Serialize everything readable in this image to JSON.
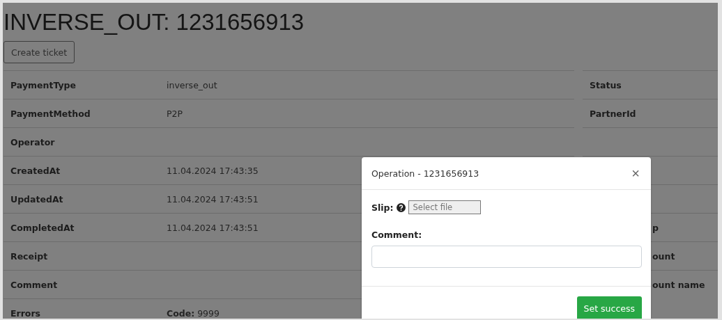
{
  "page": {
    "title": "INVERSE_OUT: 1231656913",
    "create_ticket_button": "Create ticket"
  },
  "details": {
    "rows": [
      {
        "label": "PaymentType",
        "value": "inverse_out"
      },
      {
        "label": "PaymentMethod",
        "value": "P2P"
      },
      {
        "label": "Operator"
      },
      {
        "label": "CreatedAt",
        "value": "11.04.2024 17:43:35"
      },
      {
        "label": "UpdatedAt",
        "value": "11.04.2024 17:43:51"
      },
      {
        "label": "CompletedAt",
        "value": "11.04.2024 17:43:51"
      },
      {
        "label": "Receipt"
      },
      {
        "label": "Comment"
      },
      {
        "label": "Errors",
        "value": "**Code:** 9999"
      }
    ]
  },
  "side_details": {
    "rows": [
      {
        "kind": "label",
        "label": "Status"
      },
      {
        "kind": "label",
        "label": "PartnerId"
      },
      {
        "kind": "blank"
      },
      {
        "kind": "blank"
      },
      {
        "kind": "blank"
      },
      {
        "kind": "covered",
        "label": "p"
      },
      {
        "kind": "covered",
        "label": "ount"
      },
      {
        "kind": "covered",
        "label": "ount name"
      }
    ]
  },
  "modal": {
    "title": "Operation - 1231656913",
    "close_button": "×",
    "slip_label": "Slip:",
    "file_field": {
      "placeholder": "Select file"
    },
    "comment_label": "Comment:",
    "submit_button": "Set success"
  }
}
